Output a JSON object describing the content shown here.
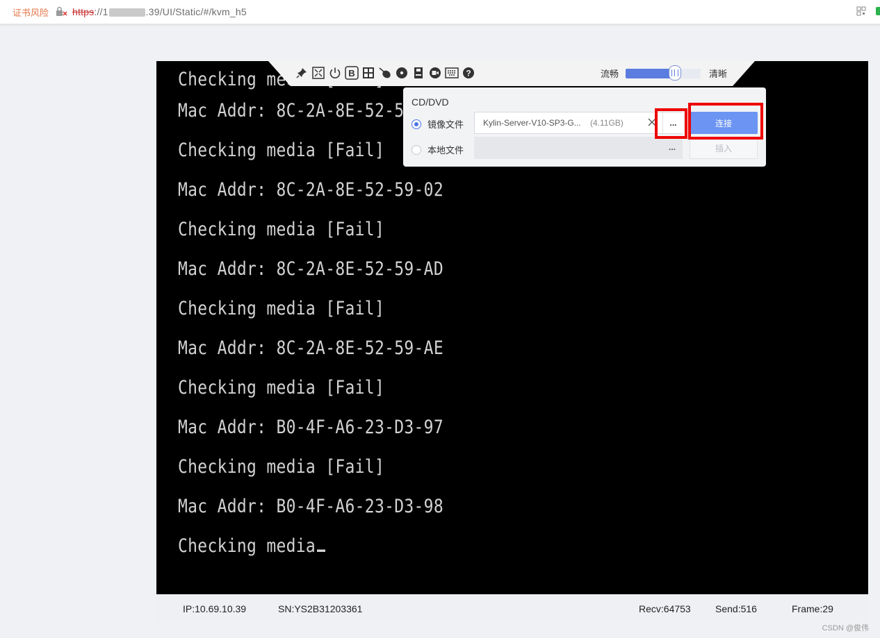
{
  "browser": {
    "cert_warning": "证书风险",
    "url_protocol": "https",
    "url_prefix": "://1",
    "url_rest": ".39/UI/Static/#/kvm_h5"
  },
  "console": {
    "lines": [
      "Checking media [Fail]",
      "Mac Addr: 8C-2A-8E-52-59-01",
      "Checking media [Fail]",
      "Mac Addr: 8C-2A-8E-52-59-02",
      "Checking media [Fail]",
      "Mac Addr: 8C-2A-8E-52-59-AD",
      "Checking media [Fail]",
      "Mac Addr: 8C-2A-8E-52-59-AE",
      "Checking media [Fail]",
      "Mac Addr: B0-4F-A6-23-D3-97",
      "Checking media [Fail]",
      "Mac Addr: B0-4F-A6-23-D3-98",
      "Checking media"
    ]
  },
  "toolbar": {
    "icons": [
      "pin-icon",
      "fullscreen-icon",
      "power-icon",
      "boot-icon",
      "keyboard-combo-icon",
      "mouse-icon",
      "cd-dvd-icon",
      "floppy-icon",
      "record-icon",
      "virtual-keyboard-icon",
      "help-icon"
    ],
    "quality_low": "流畅",
    "quality_high": "清晰",
    "quality_level": 0.66
  },
  "cd_dvd": {
    "title": "CD/DVD",
    "image_file_label": "镜像文件",
    "local_file_label": "本地文件",
    "image_file_name": "Kylin-Server-V10-SP3-G...",
    "image_file_size": "(4.11GB)",
    "browse_label": "...",
    "connect_label": "连接",
    "insert_label": "插入",
    "selected": "image_file"
  },
  "status": {
    "ip": "IP:10.69.10.39",
    "sn": "SN:YS2B31203361",
    "recv": "Recv:64753",
    "send": "Send:516",
    "frame": "Frame:29"
  },
  "watermark": "CSDN @俊伟",
  "colors": {
    "accent": "#6c94f2",
    "highlight": "#ee0000",
    "console_bg": "#000000",
    "console_text": "#d2d2d2"
  }
}
